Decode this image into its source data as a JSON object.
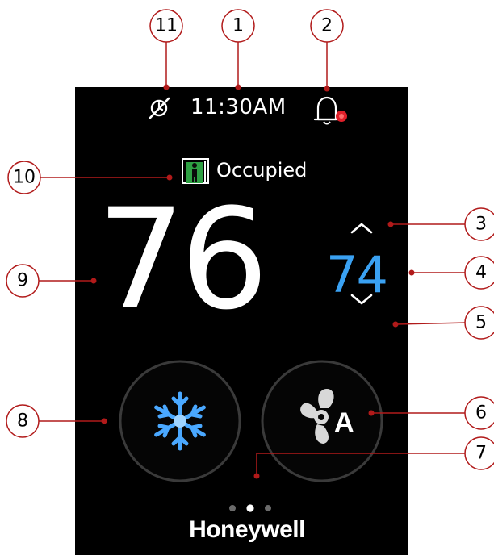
{
  "status_bar": {
    "time": "11:30AM",
    "icons": [
      "no-schedule-icon",
      "alarm-bell-icon"
    ]
  },
  "occupancy": {
    "label": "Occupied",
    "icon": "occupied-person-door-icon",
    "icon_color": "#2ea043"
  },
  "temperature": {
    "current": "76",
    "setpoint": "74",
    "setpoint_color": "#3aa1f2"
  },
  "controls": {
    "mode_icon": "snowflake-icon",
    "fan_icon": "fan-icon",
    "fan_mode": "A"
  },
  "pager": {
    "pages": 3,
    "active": 2
  },
  "brand": "Honeywell",
  "callouts": [
    "1",
    "2",
    "3",
    "4",
    "5",
    "6",
    "7",
    "8",
    "9",
    "10",
    "11"
  ],
  "colors": {
    "screen_bg": "#000000",
    "alert_red": "#e0202a",
    "ring": "#3a3a3a"
  }
}
